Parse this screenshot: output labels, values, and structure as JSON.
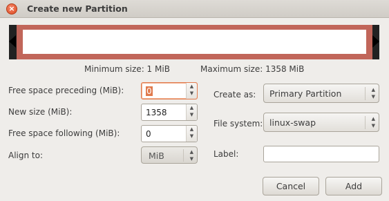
{
  "window": {
    "title": "Create new Partition",
    "close_glyph": "×"
  },
  "size_info": {
    "minimum": "Minimum size: 1 MiB",
    "maximum": "Maximum size: 1358 MiB"
  },
  "left": {
    "free_preceding": {
      "label": "Free space preceding (MiB):",
      "value": "0"
    },
    "new_size": {
      "label": "New size (MiB):",
      "value": "1358"
    },
    "free_following": {
      "label": "Free space following (MiB):",
      "value": "0"
    },
    "align_to": {
      "label": "Align to:",
      "value": "MiB"
    }
  },
  "right": {
    "create_as": {
      "label": "Create as:",
      "value": "Primary Partition"
    },
    "file_system": {
      "label": "File system:",
      "value": "linux-swap"
    },
    "partition_label": {
      "label": "Label:",
      "value": ""
    }
  },
  "buttons": {
    "cancel": "Cancel",
    "add": "Add"
  },
  "colors": {
    "partition_border": "#c1665a",
    "focus_accent": "#e07a4d"
  }
}
